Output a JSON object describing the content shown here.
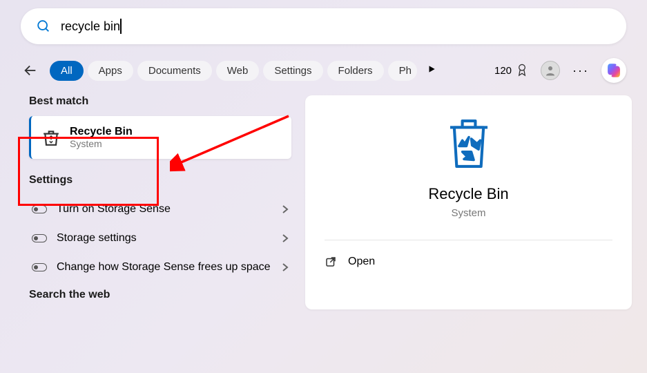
{
  "search": {
    "query": "recycle bin",
    "placeholder": ""
  },
  "filters": {
    "items": [
      "All",
      "Apps",
      "Documents",
      "Web",
      "Settings",
      "Folders",
      "Ph"
    ],
    "active_index": 0
  },
  "topbar": {
    "points": "120",
    "more": "···"
  },
  "results": {
    "best_match_label": "Best match",
    "best_match": {
      "title": "Recycle Bin",
      "subtitle": "System"
    },
    "settings_label": "Settings",
    "settings_items": [
      {
        "label": "Turn on Storage Sense"
      },
      {
        "label": "Storage settings"
      },
      {
        "label": "Change how Storage Sense frees up space"
      }
    ],
    "search_web_label": "Search the web"
  },
  "detail": {
    "title": "Recycle Bin",
    "subtitle": "System",
    "open_label": "Open"
  }
}
